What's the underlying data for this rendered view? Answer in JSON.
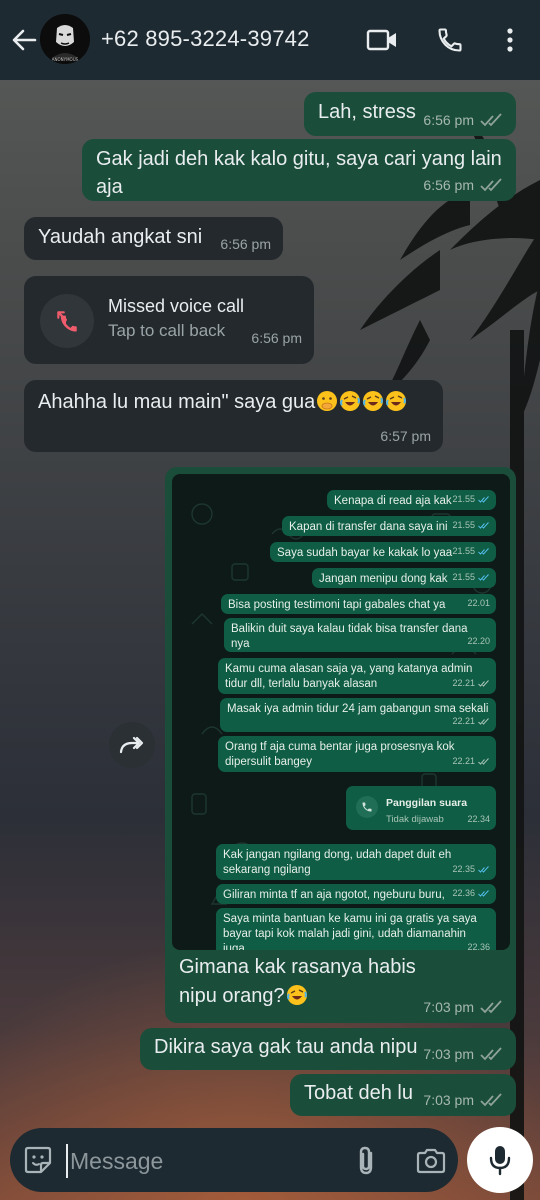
{
  "header": {
    "contact": "+62 895-3224-39742",
    "avatar_text": "ANONYMOUS"
  },
  "icons": {
    "back": "arrow-left-icon",
    "video": "video-camera-icon",
    "call": "phone-icon",
    "menu": "more-vertical-icon",
    "sticker": "sticker-icon",
    "attach": "paperclip-icon",
    "camera": "camera-icon",
    "mic": "microphone-icon",
    "forward": "forward-icon",
    "missed_call": "missed-call-icon"
  },
  "messages": [
    {
      "dir": "out",
      "text": "Lah, stress",
      "time": "6:56 pm",
      "status": "read"
    },
    {
      "dir": "out",
      "text": "Gak jadi deh kak kalo gitu, saya cari yang lain aja",
      "time": "6:56 pm",
      "status": "read"
    },
    {
      "dir": "in",
      "text": "Yaudah angkat sni",
      "time": "6:56 pm"
    },
    {
      "dir": "in",
      "type": "missed_call",
      "title": "Missed voice call",
      "subtitle": "Tap to call back",
      "time": "6:56 pm"
    },
    {
      "dir": "in",
      "text": "Ahahha lu mau main\" saya gua",
      "time": "6:57 pm"
    },
    {
      "dir": "out",
      "type": "image_caption",
      "text": "Gimana kak rasanya habis nipu orang?",
      "time": "7:03 pm",
      "status": "read"
    },
    {
      "dir": "out",
      "text": "Dikira saya gak tau anda nipu",
      "time": "7:03 pm",
      "status": "read"
    },
    {
      "dir": "out",
      "text": "Tobat deh lu",
      "time": "7:03 pm",
      "status": "read"
    }
  ],
  "embedded": {
    "messages": [
      {
        "text": "Kenapa di read aja kak",
        "time": "21.55"
      },
      {
        "text": "Kapan di transfer dana saya ini",
        "time": "21.55"
      },
      {
        "text": "Saya sudah bayar ke kakak lo yaa",
        "time": "21.55"
      },
      {
        "text": "Jangan menipu dong kak",
        "time": "21.55"
      },
      {
        "text": "Bisa posting testimoni tapi gabales chat ya",
        "time": "22.01"
      },
      {
        "text": "Balikin duit saya kalau tidak bisa transfer dana nya",
        "time": "22.20"
      },
      {
        "text": "Kamu cuma alasan saja ya, yang katanya admin tidur dll, terlalu banyak alasan",
        "time": "22.21"
      },
      {
        "text": "Masak iya admin tidur 24 jam gabangun sma sekali",
        "time": "22.21"
      },
      {
        "text": "Orang tf aja cuma bentar juga prosesnya kok dipersulit bangey",
        "time": "22.21"
      },
      {
        "text": "Kak jangan ngilang dong, udah dapet duit eh sekarang ngilang",
        "time": "22.35"
      },
      {
        "text": "Giliran minta tf an aja ngotot, ngeburu buru,",
        "time": "22.36"
      },
      {
        "text": "Saya minta bantuan ke kamu ini ga gratis ya saya bayar tapi kok malah jadi gini, udah diamanahin juga",
        "time": "22.36"
      }
    ],
    "call": {
      "title": "Panggilan suara",
      "subtitle": "Tidak dijawab",
      "time": "22.34"
    }
  },
  "input": {
    "placeholder": "Message"
  },
  "colors": {
    "header_bg": "#1e2a31",
    "outgoing_bubble": "#1a4d3a",
    "incoming_bubble": "#24292d",
    "missed_call_red": "#f15c6d",
    "tick_blue": "#53bdeb"
  }
}
